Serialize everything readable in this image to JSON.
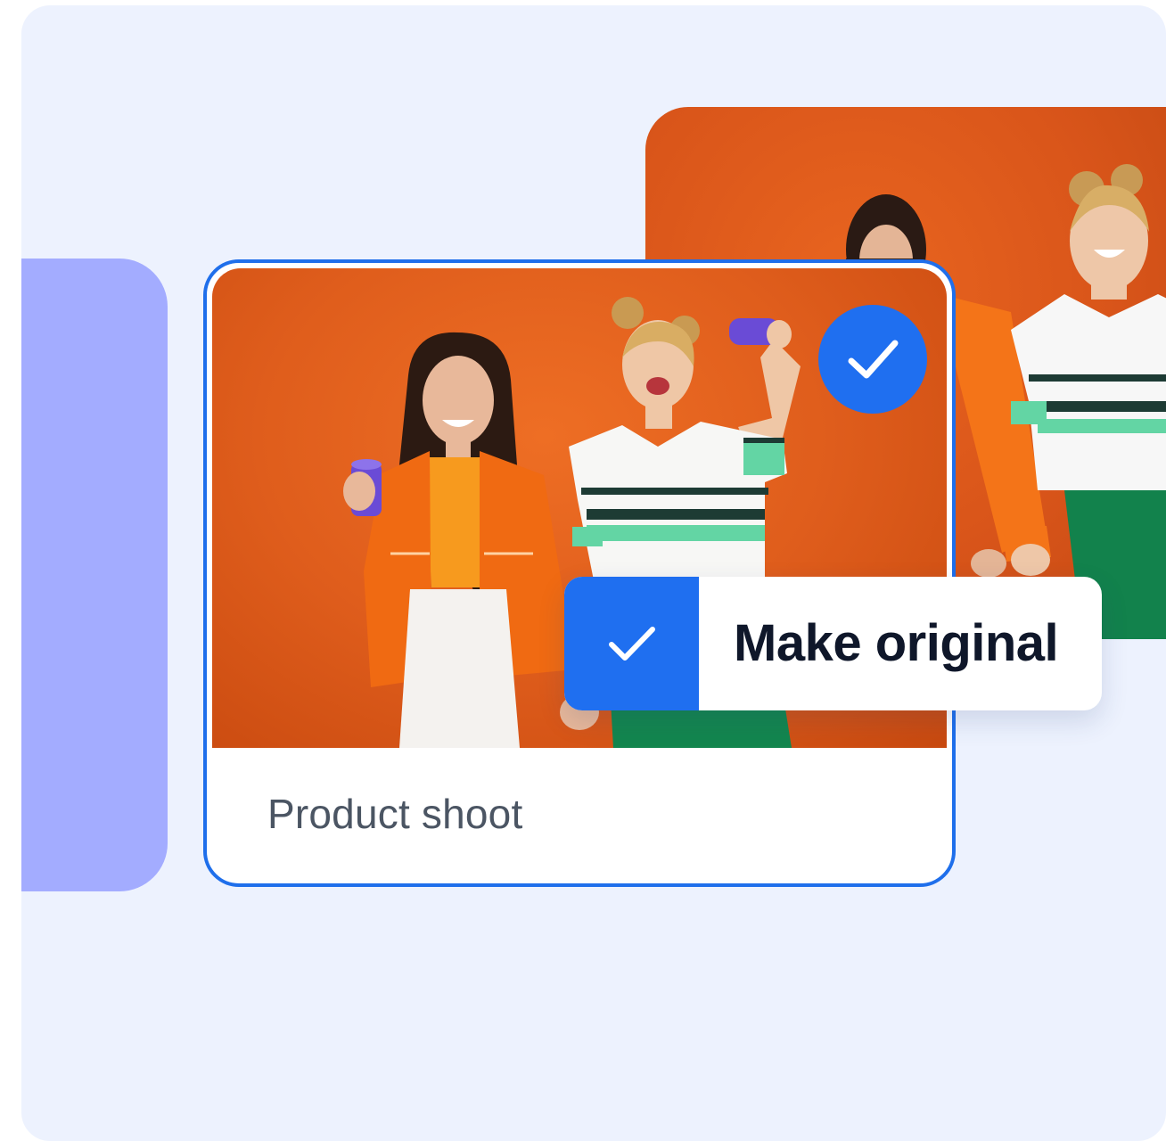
{
  "card": {
    "caption": "Product shoot"
  },
  "action": {
    "label": "Make original"
  },
  "colors": {
    "page_background": "#edf2fe",
    "side_panel": "#a3acff",
    "accent_blue": "#1f6ff0",
    "photo_backdrop": "#df5d1c",
    "caption_text": "#4b5563",
    "action_text": "#0f172a"
  },
  "icons": {
    "selected_badge": "checkmark-icon",
    "action_check": "checkmark-icon"
  }
}
